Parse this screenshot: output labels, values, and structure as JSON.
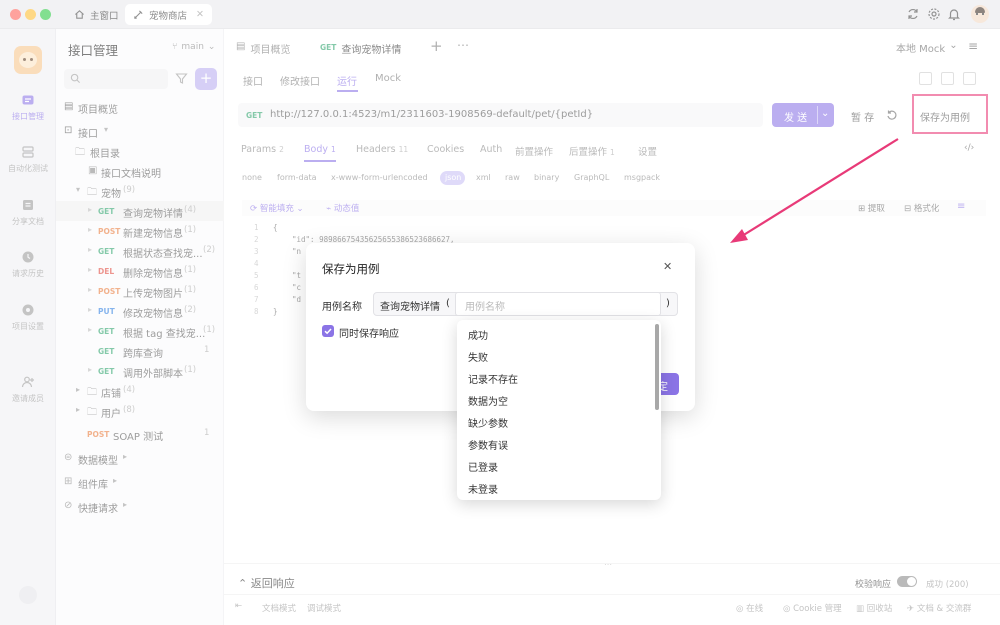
{
  "titlebar": {
    "tabs": [
      {
        "label": "主窗口"
      },
      {
        "label": "宠物商店"
      }
    ]
  },
  "rail": {
    "items": [
      {
        "label": "接口管理"
      },
      {
        "label": "自动化测试"
      },
      {
        "label": "分享文档"
      },
      {
        "label": "请求历史"
      },
      {
        "label": "项目设置"
      },
      {
        "label": "邀请成员"
      }
    ]
  },
  "sidebar": {
    "title": "接口管理",
    "branch": "main",
    "tree": {
      "overview": "项目概览",
      "api": "接口",
      "root": "根目录",
      "doc": "接口文档说明",
      "pets_folder": {
        "label": "宠物",
        "count": "(9)"
      },
      "items": [
        {
          "method": "GET",
          "name": "查询宠物详情",
          "count": "(4)"
        },
        {
          "method": "POST",
          "name": "新建宠物信息",
          "count": "(1)"
        },
        {
          "method": "GET",
          "name": "根据状态查找宠...",
          "count": "(2)"
        },
        {
          "method": "DEL",
          "name": "删除宠物信息",
          "count": "(1)"
        },
        {
          "method": "POST",
          "name": "上传宠物图片",
          "count": "(1)"
        },
        {
          "method": "PUT",
          "name": "修改宠物信息",
          "count": "(2)"
        },
        {
          "method": "GET",
          "name": "根据 tag 查找宠...",
          "count": "(1)"
        },
        {
          "method": "GET",
          "name": "跨库查询",
          "count": "1"
        },
        {
          "method": "GET",
          "name": "调用外部脚本",
          "count": "(1)"
        }
      ],
      "store_folder": {
        "label": "店铺",
        "count": "(4)"
      },
      "user_folder": {
        "label": "用户",
        "count": "(8)"
      },
      "soap": {
        "method": "POST",
        "name": "SOAP 测试",
        "count": "1"
      },
      "data_models": "数据模型",
      "components": "组件库",
      "quick_requests": "快捷请求"
    }
  },
  "main": {
    "tabs": {
      "overview": "项目概览",
      "method": "GET",
      "current": "查询宠物详情"
    },
    "mock": "本地 Mock",
    "subtabs": [
      "接口",
      "修改接口",
      "运行",
      "Mock"
    ],
    "url": {
      "method": "GET",
      "value": "http://127.0.0.1:4523/m1/2311603-1908569-default/pet/{petId}"
    },
    "send": "发 送",
    "save": "暂 存",
    "save_as_case": "保存为用例",
    "param_tabs": [
      {
        "label": "Params",
        "count": "2"
      },
      {
        "label": "Body",
        "count": "1"
      },
      {
        "label": "Headers",
        "count": "11"
      },
      {
        "label": "Cookies",
        "count": ""
      },
      {
        "label": "Auth",
        "count": ""
      },
      {
        "label": "前置操作",
        "count": ""
      },
      {
        "label": "后置操作",
        "count": "1"
      },
      {
        "label": "设置",
        "count": ""
      }
    ],
    "body_types": [
      "none",
      "form-data",
      "x-www-form-urlencoded",
      "json",
      "xml",
      "raw",
      "binary",
      "GraphQL",
      "msgpack"
    ],
    "smart_mock": "智能填充",
    "dynamic_value": "动态值",
    "extract": "提取",
    "format": "格式化",
    "code": {
      "line_numbers": [
        "1",
        "2",
        "3",
        "4",
        "5",
        "6",
        "7",
        "8"
      ],
      "lines": [
        "{",
        "\"id\": 98986675435625655386523686627,",
        "\"n",
        "",
        "\"t",
        "\"c",
        "\"d",
        "}"
      ]
    },
    "response_title": "返回响应",
    "validate": "校验响应",
    "status": "成功 (200)",
    "doc_mode": "文档模式",
    "debug_mode": "调试模式",
    "footer": [
      "在线",
      "Cookie 管理",
      "回收站",
      "文档 & 交流群"
    ]
  },
  "modal": {
    "title": "保存为用例",
    "label": "用例名称",
    "prefix": "查询宠物详情",
    "open_paren": "(",
    "close_paren": ")",
    "placeholder": "用例名称",
    "checkbox": "同时保存响应",
    "confirm": "定"
  },
  "dropdown": {
    "options": [
      "成功",
      "失败",
      "记录不存在",
      "数据为空",
      "缺少参数",
      "参数有误",
      "已登录",
      "未登录"
    ]
  },
  "colors": {
    "accent": "#8b74e6",
    "annotation": "#e83a78",
    "get": "#2ca36b",
    "post": "#e87a3c",
    "del": "#e0483d",
    "put": "#2d7fe0"
  }
}
